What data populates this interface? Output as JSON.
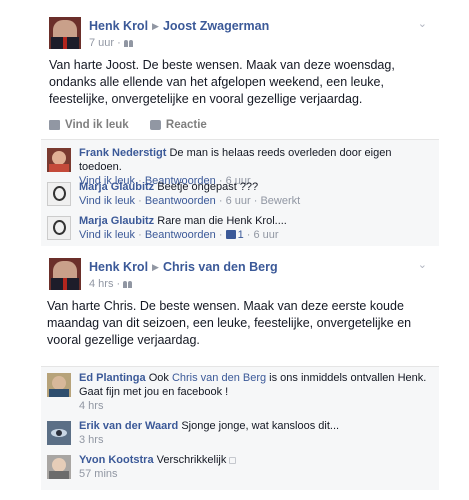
{
  "post1": {
    "author": "Henk Krol",
    "target": "Joost Zwagerman",
    "time": "7 uur",
    "text": "Van harte Joost. De beste wensen. Maak van deze woensdag, ondanks alle ellende van het afgelopen weekend, een leuke, feestelijke, onvergetelijke en vooral gezellige verjaardag.",
    "like_label": "Vind ik leuk",
    "comment_label": "Reactie",
    "comments": [
      {
        "name": "Frank Nederstigt",
        "text": "De man is helaas reeds overleden door eigen toedoen.",
        "like": "Vind ik leuk",
        "reply": "Beantwoorden",
        "time": "6 uur",
        "extra": ""
      },
      {
        "name": "Marja Glaubitz",
        "text": "Beetje ongepast ???",
        "like": "Vind ik leuk",
        "reply": "Beantwoorden",
        "time": "6 uur",
        "extra": "Bewerkt"
      },
      {
        "name": "Marja Glaubitz",
        "text": "Rare man die Henk Krol....",
        "like": "Vind ik leuk",
        "reply": "Beantwoorden",
        "likes": "1",
        "time": "6 uur"
      }
    ]
  },
  "post2": {
    "author": "Henk Krol",
    "target": "Chris van den Berg",
    "time": "4 hrs",
    "text": "Van harte Chris. De beste wensen. Maak van deze eerste koude maandag van dit seizoen, een leuke, feestelijke, onvergetelijke en vooral gezellige verjaardag.",
    "comments": [
      {
        "name": "Ed Plantinga",
        "pre": "Ook",
        "mention": "Chris van den Berg",
        "post": "is ons inmiddels ontvallen Henk. Gaat fijn met jou en facebook !",
        "time": "4 hrs"
      },
      {
        "name": "Erik van der Waard",
        "text": "Sjonge jonge, wat kansloos dit...",
        "time": "3 hrs"
      },
      {
        "name": "Yvon Kootstra",
        "text": "Verschrikkelijk",
        "time": "57 mins"
      }
    ]
  },
  "colors": {
    "link": "#3b5998",
    "meta": "#9197a3",
    "comment_bg": "#f6f7f8"
  },
  "icons": [
    "play-arrow-icon",
    "friends-icon",
    "chevron-down-icon",
    "like-thumb-icon",
    "comment-bubble-icon",
    "globe-icon"
  ]
}
